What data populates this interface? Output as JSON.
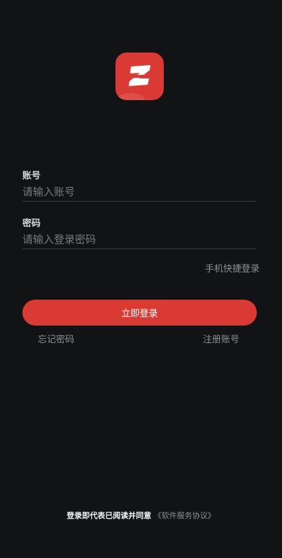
{
  "brand": {
    "logo_letter": "Z",
    "accent_color": "#d93a33",
    "background_color": "#121315"
  },
  "form": {
    "account": {
      "label": "账号",
      "placeholder": "请输入账号",
      "value": ""
    },
    "password": {
      "label": "密码",
      "placeholder": "请输入登录密码",
      "value": ""
    }
  },
  "links": {
    "quick_login": "手机快捷登录",
    "forgot_password": "忘记密码",
    "register": "注册账号"
  },
  "buttons": {
    "login": "立即登录"
  },
  "agreement": {
    "text": "登录即代表已阅读并同意",
    "link": "《软件服务协议》"
  }
}
